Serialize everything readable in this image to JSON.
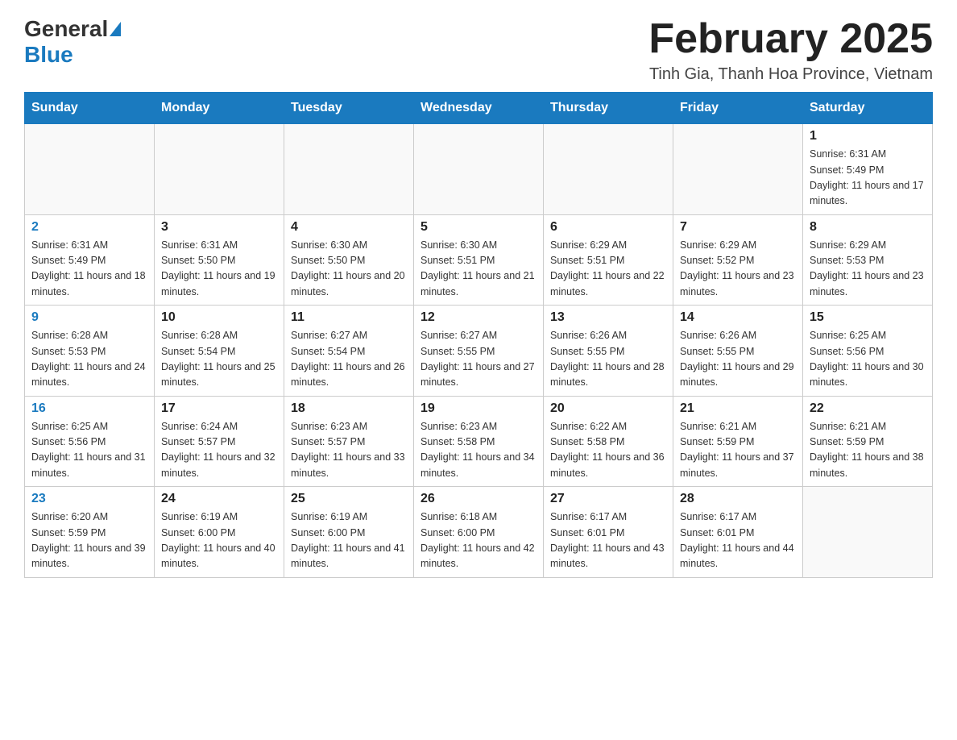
{
  "header": {
    "logo": {
      "general": "General",
      "blue": "Blue"
    },
    "title": "February 2025",
    "location": "Tinh Gia, Thanh Hoa Province, Vietnam"
  },
  "weekdays": [
    "Sunday",
    "Monday",
    "Tuesday",
    "Wednesday",
    "Thursday",
    "Friday",
    "Saturday"
  ],
  "weeks": [
    [
      {
        "day": "",
        "info": ""
      },
      {
        "day": "",
        "info": ""
      },
      {
        "day": "",
        "info": ""
      },
      {
        "day": "",
        "info": ""
      },
      {
        "day": "",
        "info": ""
      },
      {
        "day": "",
        "info": ""
      },
      {
        "day": "1",
        "info": "Sunrise: 6:31 AM\nSunset: 5:49 PM\nDaylight: 11 hours and 17 minutes."
      }
    ],
    [
      {
        "day": "2",
        "info": "Sunrise: 6:31 AM\nSunset: 5:49 PM\nDaylight: 11 hours and 18 minutes."
      },
      {
        "day": "3",
        "info": "Sunrise: 6:31 AM\nSunset: 5:50 PM\nDaylight: 11 hours and 19 minutes."
      },
      {
        "day": "4",
        "info": "Sunrise: 6:30 AM\nSunset: 5:50 PM\nDaylight: 11 hours and 20 minutes."
      },
      {
        "day": "5",
        "info": "Sunrise: 6:30 AM\nSunset: 5:51 PM\nDaylight: 11 hours and 21 minutes."
      },
      {
        "day": "6",
        "info": "Sunrise: 6:29 AM\nSunset: 5:51 PM\nDaylight: 11 hours and 22 minutes."
      },
      {
        "day": "7",
        "info": "Sunrise: 6:29 AM\nSunset: 5:52 PM\nDaylight: 11 hours and 23 minutes."
      },
      {
        "day": "8",
        "info": "Sunrise: 6:29 AM\nSunset: 5:53 PM\nDaylight: 11 hours and 23 minutes."
      }
    ],
    [
      {
        "day": "9",
        "info": "Sunrise: 6:28 AM\nSunset: 5:53 PM\nDaylight: 11 hours and 24 minutes."
      },
      {
        "day": "10",
        "info": "Sunrise: 6:28 AM\nSunset: 5:54 PM\nDaylight: 11 hours and 25 minutes."
      },
      {
        "day": "11",
        "info": "Sunrise: 6:27 AM\nSunset: 5:54 PM\nDaylight: 11 hours and 26 minutes."
      },
      {
        "day": "12",
        "info": "Sunrise: 6:27 AM\nSunset: 5:55 PM\nDaylight: 11 hours and 27 minutes."
      },
      {
        "day": "13",
        "info": "Sunrise: 6:26 AM\nSunset: 5:55 PM\nDaylight: 11 hours and 28 minutes."
      },
      {
        "day": "14",
        "info": "Sunrise: 6:26 AM\nSunset: 5:55 PM\nDaylight: 11 hours and 29 minutes."
      },
      {
        "day": "15",
        "info": "Sunrise: 6:25 AM\nSunset: 5:56 PM\nDaylight: 11 hours and 30 minutes."
      }
    ],
    [
      {
        "day": "16",
        "info": "Sunrise: 6:25 AM\nSunset: 5:56 PM\nDaylight: 11 hours and 31 minutes."
      },
      {
        "day": "17",
        "info": "Sunrise: 6:24 AM\nSunset: 5:57 PM\nDaylight: 11 hours and 32 minutes."
      },
      {
        "day": "18",
        "info": "Sunrise: 6:23 AM\nSunset: 5:57 PM\nDaylight: 11 hours and 33 minutes."
      },
      {
        "day": "19",
        "info": "Sunrise: 6:23 AM\nSunset: 5:58 PM\nDaylight: 11 hours and 34 minutes."
      },
      {
        "day": "20",
        "info": "Sunrise: 6:22 AM\nSunset: 5:58 PM\nDaylight: 11 hours and 36 minutes."
      },
      {
        "day": "21",
        "info": "Sunrise: 6:21 AM\nSunset: 5:59 PM\nDaylight: 11 hours and 37 minutes."
      },
      {
        "day": "22",
        "info": "Sunrise: 6:21 AM\nSunset: 5:59 PM\nDaylight: 11 hours and 38 minutes."
      }
    ],
    [
      {
        "day": "23",
        "info": "Sunrise: 6:20 AM\nSunset: 5:59 PM\nDaylight: 11 hours and 39 minutes."
      },
      {
        "day": "24",
        "info": "Sunrise: 6:19 AM\nSunset: 6:00 PM\nDaylight: 11 hours and 40 minutes."
      },
      {
        "day": "25",
        "info": "Sunrise: 6:19 AM\nSunset: 6:00 PM\nDaylight: 11 hours and 41 minutes."
      },
      {
        "day": "26",
        "info": "Sunrise: 6:18 AM\nSunset: 6:00 PM\nDaylight: 11 hours and 42 minutes."
      },
      {
        "day": "27",
        "info": "Sunrise: 6:17 AM\nSunset: 6:01 PM\nDaylight: 11 hours and 43 minutes."
      },
      {
        "day": "28",
        "info": "Sunrise: 6:17 AM\nSunset: 6:01 PM\nDaylight: 11 hours and 44 minutes."
      },
      {
        "day": "",
        "info": ""
      }
    ]
  ]
}
